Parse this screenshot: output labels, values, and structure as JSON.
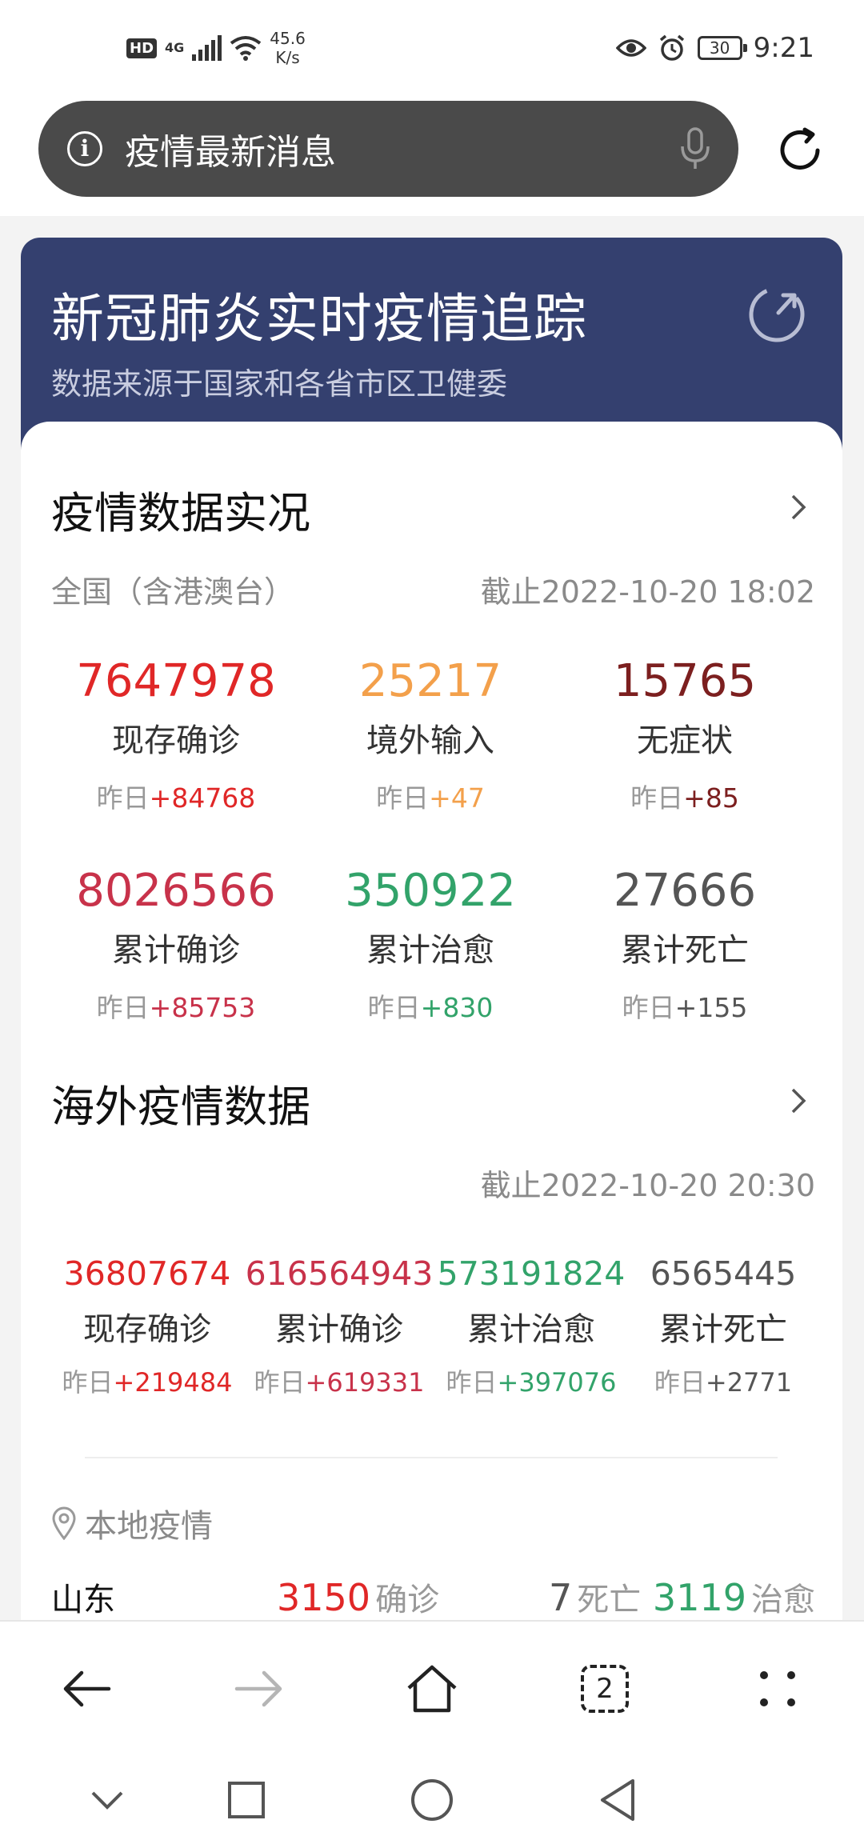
{
  "status_bar": {
    "hd": "HD",
    "network": "4G",
    "speed_value": "45.6",
    "speed_unit": "K/s",
    "battery": "30",
    "time": "9:21"
  },
  "search": {
    "query": "疫情最新消息"
  },
  "header": {
    "title": "新冠肺炎实时疫情追踪",
    "subtitle": "数据来源于国家和各省市区卫健委"
  },
  "domestic": {
    "title": "疫情数据实况",
    "region": "全国（含港澳台）",
    "updated": "截止2022-10-20 18:02",
    "stats": [
      {
        "value": "7647978",
        "label": "现存确诊",
        "delta_prefix": "昨日",
        "delta": "+84768",
        "color": "#e02727"
      },
      {
        "value": "25217",
        "label": "境外输入",
        "delta_prefix": "昨日",
        "delta": "+47",
        "color": "#f3a04b"
      },
      {
        "value": "15765",
        "label": "无症状",
        "delta_prefix": "昨日",
        "delta": "+85",
        "color": "#7c1f1f"
      },
      {
        "value": "8026566",
        "label": "累计确诊",
        "delta_prefix": "昨日",
        "delta": "+85753",
        "color": "#c8324a"
      },
      {
        "value": "350922",
        "label": "累计治愈",
        "delta_prefix": "昨日",
        "delta": "+830",
        "color": "#32a36a"
      },
      {
        "value": "27666",
        "label": "累计死亡",
        "delta_prefix": "昨日",
        "delta": "+155",
        "color": "#555555"
      }
    ]
  },
  "overseas": {
    "title": "海外疫情数据",
    "updated": "截止2022-10-20 20:30",
    "stats": [
      {
        "value": "36807674",
        "label": "现存确诊",
        "delta_prefix": "昨日",
        "delta": "+219484",
        "color": "#e02727"
      },
      {
        "value": "616564943",
        "label": "累计确诊",
        "delta_prefix": "昨日",
        "delta": "+619331",
        "color": "#c8324a"
      },
      {
        "value": "573191824",
        "label": "累计治愈",
        "delta_prefix": "昨日",
        "delta": "+397076",
        "color": "#32a36a"
      },
      {
        "value": "6565445",
        "label": "累计死亡",
        "delta_prefix": "昨日",
        "delta": "+2771",
        "color": "#555555"
      }
    ]
  },
  "local": {
    "label": "本地疫情",
    "province": "山东",
    "confirmed": "3150",
    "confirmed_unit": "确诊",
    "deaths": "7",
    "deaths_unit": "死亡",
    "recovered": "3119",
    "recovered_unit": "治愈"
  },
  "toolbar": {
    "tab_count": "2"
  },
  "icons": {
    "search_info": "info-icon",
    "search_mic": "mic-icon",
    "refresh": "refresh-icon",
    "back": "back-arrow-icon",
    "forward": "forward-arrow-icon",
    "home": "home-icon",
    "tabs": "tabs-icon",
    "menu": "menu-icon"
  }
}
